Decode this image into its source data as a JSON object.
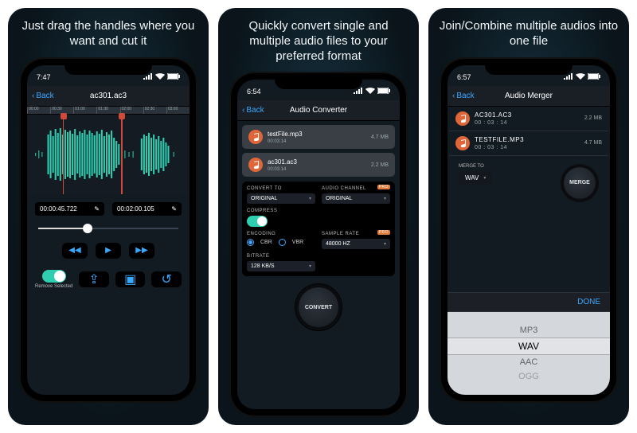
{
  "panels": [
    {
      "headline": "Just drag the handles where you want and cut it"
    },
    {
      "headline": "Quickly convert single and multiple audio files to your preferred format"
    },
    {
      "headline": "Join/Combine multiple audios into one file"
    }
  ],
  "s1": {
    "time": "7:47",
    "back": "Back",
    "title": "ac301.ac3",
    "ticks": [
      "00:00",
      "00:30",
      "01:00",
      "01:30",
      "02:00",
      "02:30",
      "03:00"
    ],
    "start": "00:00:45.722",
    "end": "00:02:00.105",
    "remove": "Remove Selected"
  },
  "s2": {
    "time": "6:54",
    "back": "Back",
    "title": "Audio Converter",
    "files": [
      {
        "name": "testFile.mp3",
        "dur": "00:03:14",
        "size": "4.7 MB"
      },
      {
        "name": "ac301.ac3",
        "dur": "00:03:14",
        "size": "2.2 MB"
      }
    ],
    "convert_to_label": "CONVERT TO",
    "convert_to": "ORIGINAL",
    "audio_channel_label": "AUDIO CHANNEL",
    "audio_channel": "ORIGINAL",
    "compress_label": "COMPRESS",
    "encoding_label": "ENCODING",
    "cbr": "CBR",
    "vbr": "VBR",
    "sample_label": "SAMPLE RATE",
    "sample": "48000 HZ",
    "bitrate_label": "BITRATE",
    "bitrate": "128 KB/S",
    "pro": "PRO",
    "convert_btn": "CONVERT"
  },
  "s3": {
    "time": "6:57",
    "back": "Back",
    "title": "Audio Merger",
    "files": [
      {
        "name": "AC301.AC3",
        "dur": "00 : 03 : 14",
        "size": "2.2 MB"
      },
      {
        "name": "TESTFILE.MP3",
        "dur": "00 : 03 : 14",
        "size": "4.7 MB"
      }
    ],
    "merge_to_label": "MERGE TO",
    "merge_to": "WAV",
    "merge_btn": "MERGE",
    "done": "DONE",
    "picker": [
      "MP3",
      "WAV",
      "AAC",
      "OGG"
    ]
  }
}
